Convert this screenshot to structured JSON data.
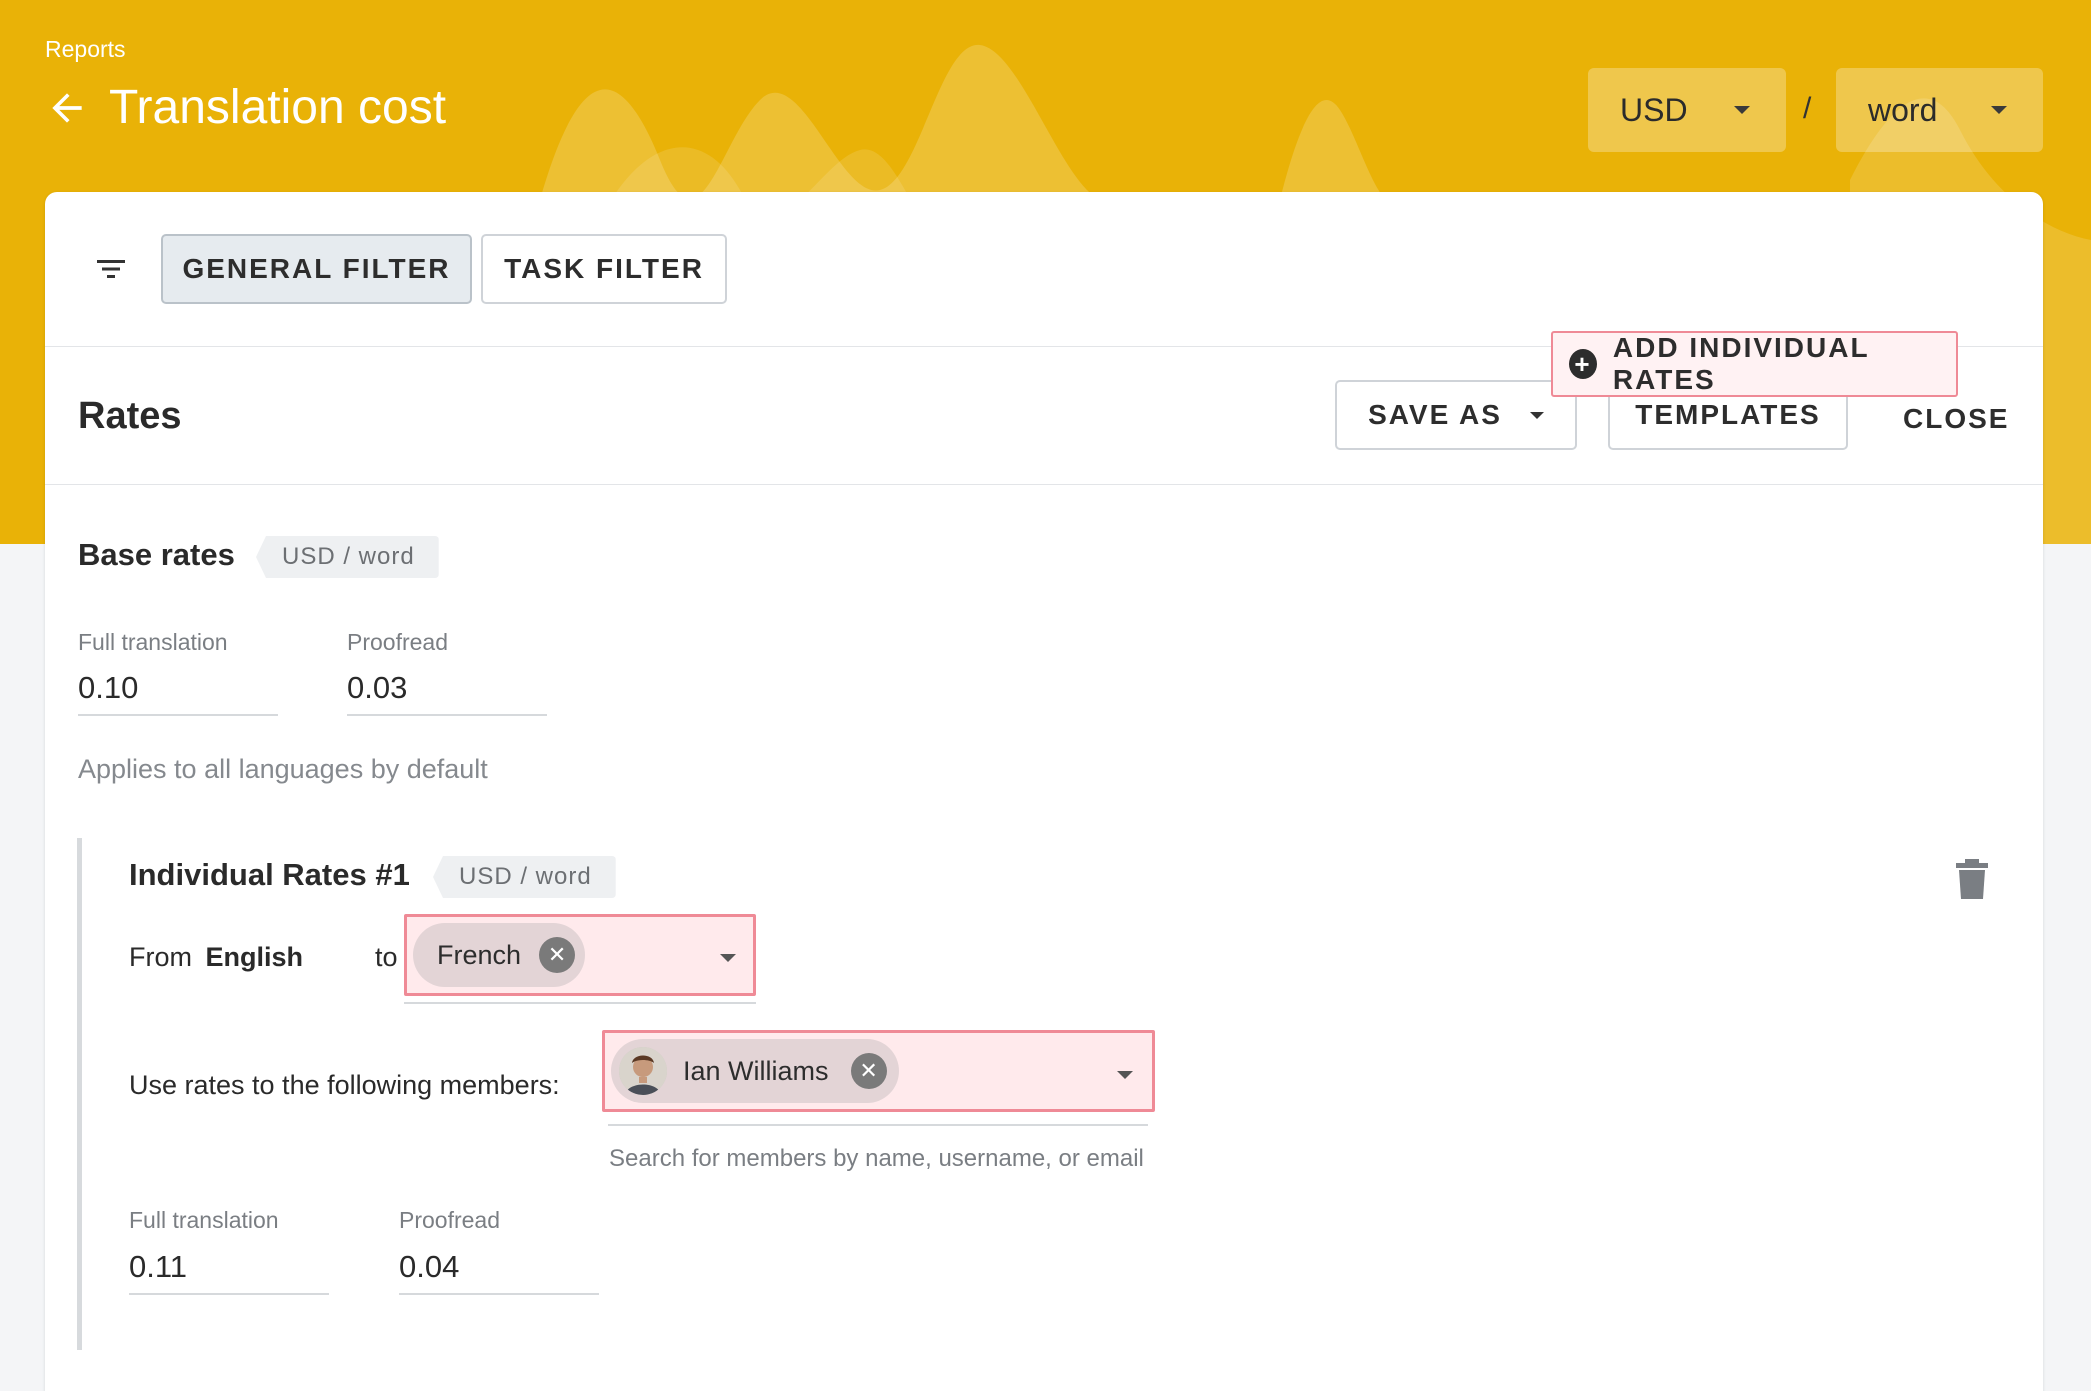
{
  "header": {
    "breadcrumb": "Reports",
    "title": "Translation cost",
    "currency": "USD",
    "separator": "/",
    "unit": "word"
  },
  "filters": {
    "general_label": "GENERAL FILTER",
    "task_label": "TASK FILTER",
    "active": "general"
  },
  "rates": {
    "title": "Rates",
    "save_as_label": "SAVE AS",
    "templates_label": "TEMPLATES",
    "close_label": "CLOSE",
    "add_individual_label": "ADD INDIVIDUAL RATES",
    "base": {
      "title": "Base rates",
      "unit_tag": "USD / word",
      "full_translation_label": "Full translation",
      "full_translation_value": "0.10",
      "proofread_label": "Proofread",
      "proofread_value": "0.03",
      "hint": "Applies to all languages by default"
    },
    "individual": {
      "title": "Individual Rates #1",
      "unit_tag": "USD / word",
      "from_label": "From",
      "from_language": "English",
      "to_label": "to",
      "to_language": "French",
      "members_label": "Use rates to the following members:",
      "member_name": "Ian Williams",
      "members_hint": "Search for members by name, username, or email",
      "full_translation_label": "Full translation",
      "full_translation_value": "0.11",
      "proofread_label": "Proofread",
      "proofread_value": "0.04"
    }
  },
  "icons": {
    "back": "arrow-left-icon",
    "filter": "filter-lines-icon",
    "caret": "caret-down-icon",
    "add": "plus-circle-icon",
    "delete": "trash-icon",
    "remove": "close-circle-icon"
  },
  "colors": {
    "banner": "#e9b207",
    "highlight_border": "#ef8a96",
    "highlight_fill": "#ffeaec"
  }
}
